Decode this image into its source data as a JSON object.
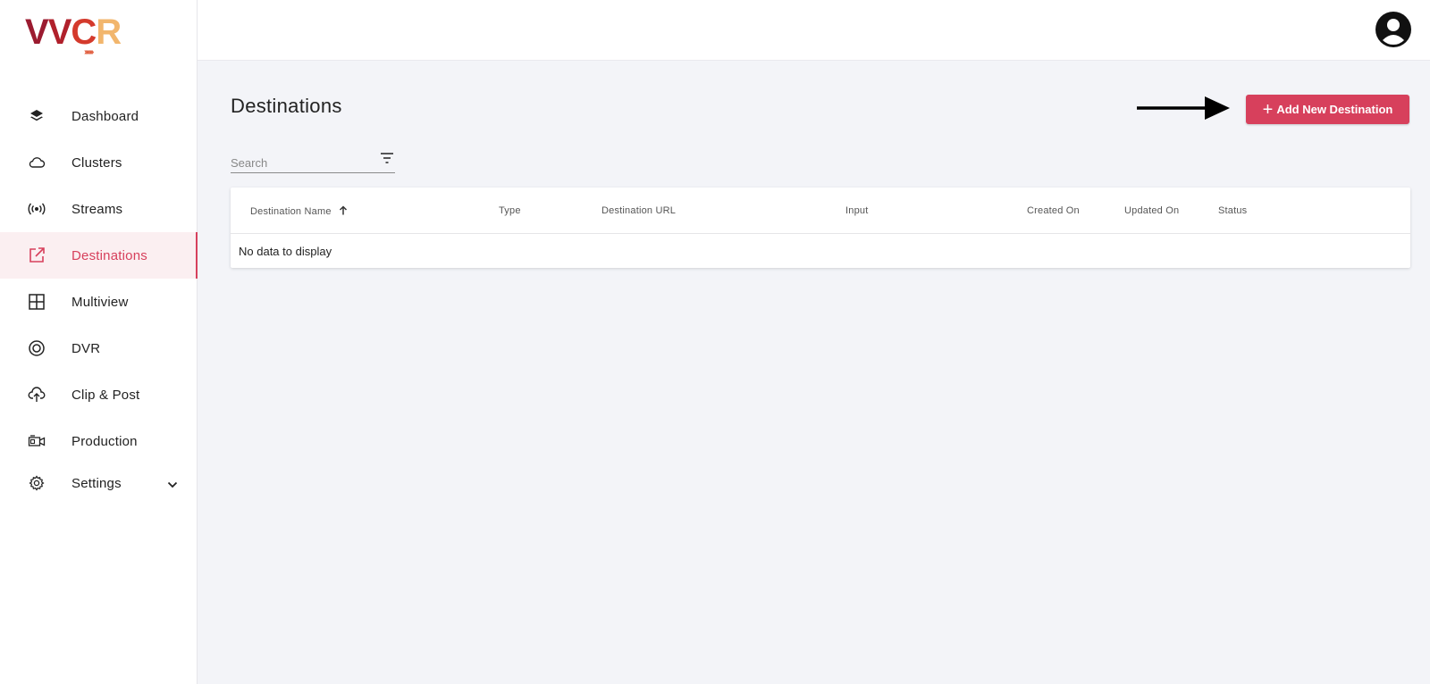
{
  "brand": {
    "logo_text": [
      "V",
      "V",
      "C",
      "R"
    ],
    "logo_chevrons": "›››››››",
    "colors": {
      "accent": "#d7405c",
      "logo_dark": "#9b1b30",
      "logo_light": "#f2b66d"
    }
  },
  "sidebar": {
    "items": [
      {
        "label": "Dashboard",
        "icon": "layers-icon"
      },
      {
        "label": "Clusters",
        "icon": "cloud-icon"
      },
      {
        "label": "Streams",
        "icon": "broadcast-icon"
      },
      {
        "label": "Destinations",
        "icon": "external-link-icon",
        "active": true
      },
      {
        "label": "Multiview",
        "icon": "grid-icon"
      },
      {
        "label": "DVR",
        "icon": "record-icon"
      },
      {
        "label": "Clip & Post",
        "icon": "cloud-upload-icon"
      },
      {
        "label": "Production",
        "icon": "camera-icon"
      },
      {
        "label": "Settings",
        "icon": "gear-icon",
        "expandable": true
      }
    ]
  },
  "header": {
    "avatar_icon": "user-avatar-icon"
  },
  "main": {
    "title": "Destinations",
    "add_button_label": "Add New Destination",
    "search": {
      "placeholder": "Search",
      "value": ""
    },
    "table": {
      "columns": [
        "Destination Name",
        "Type",
        "Destination URL",
        "Input",
        "Created On",
        "Updated On",
        "Status"
      ],
      "sorted_column": "Destination Name",
      "sort_direction": "ascending",
      "empty_message": "No data to display"
    }
  }
}
